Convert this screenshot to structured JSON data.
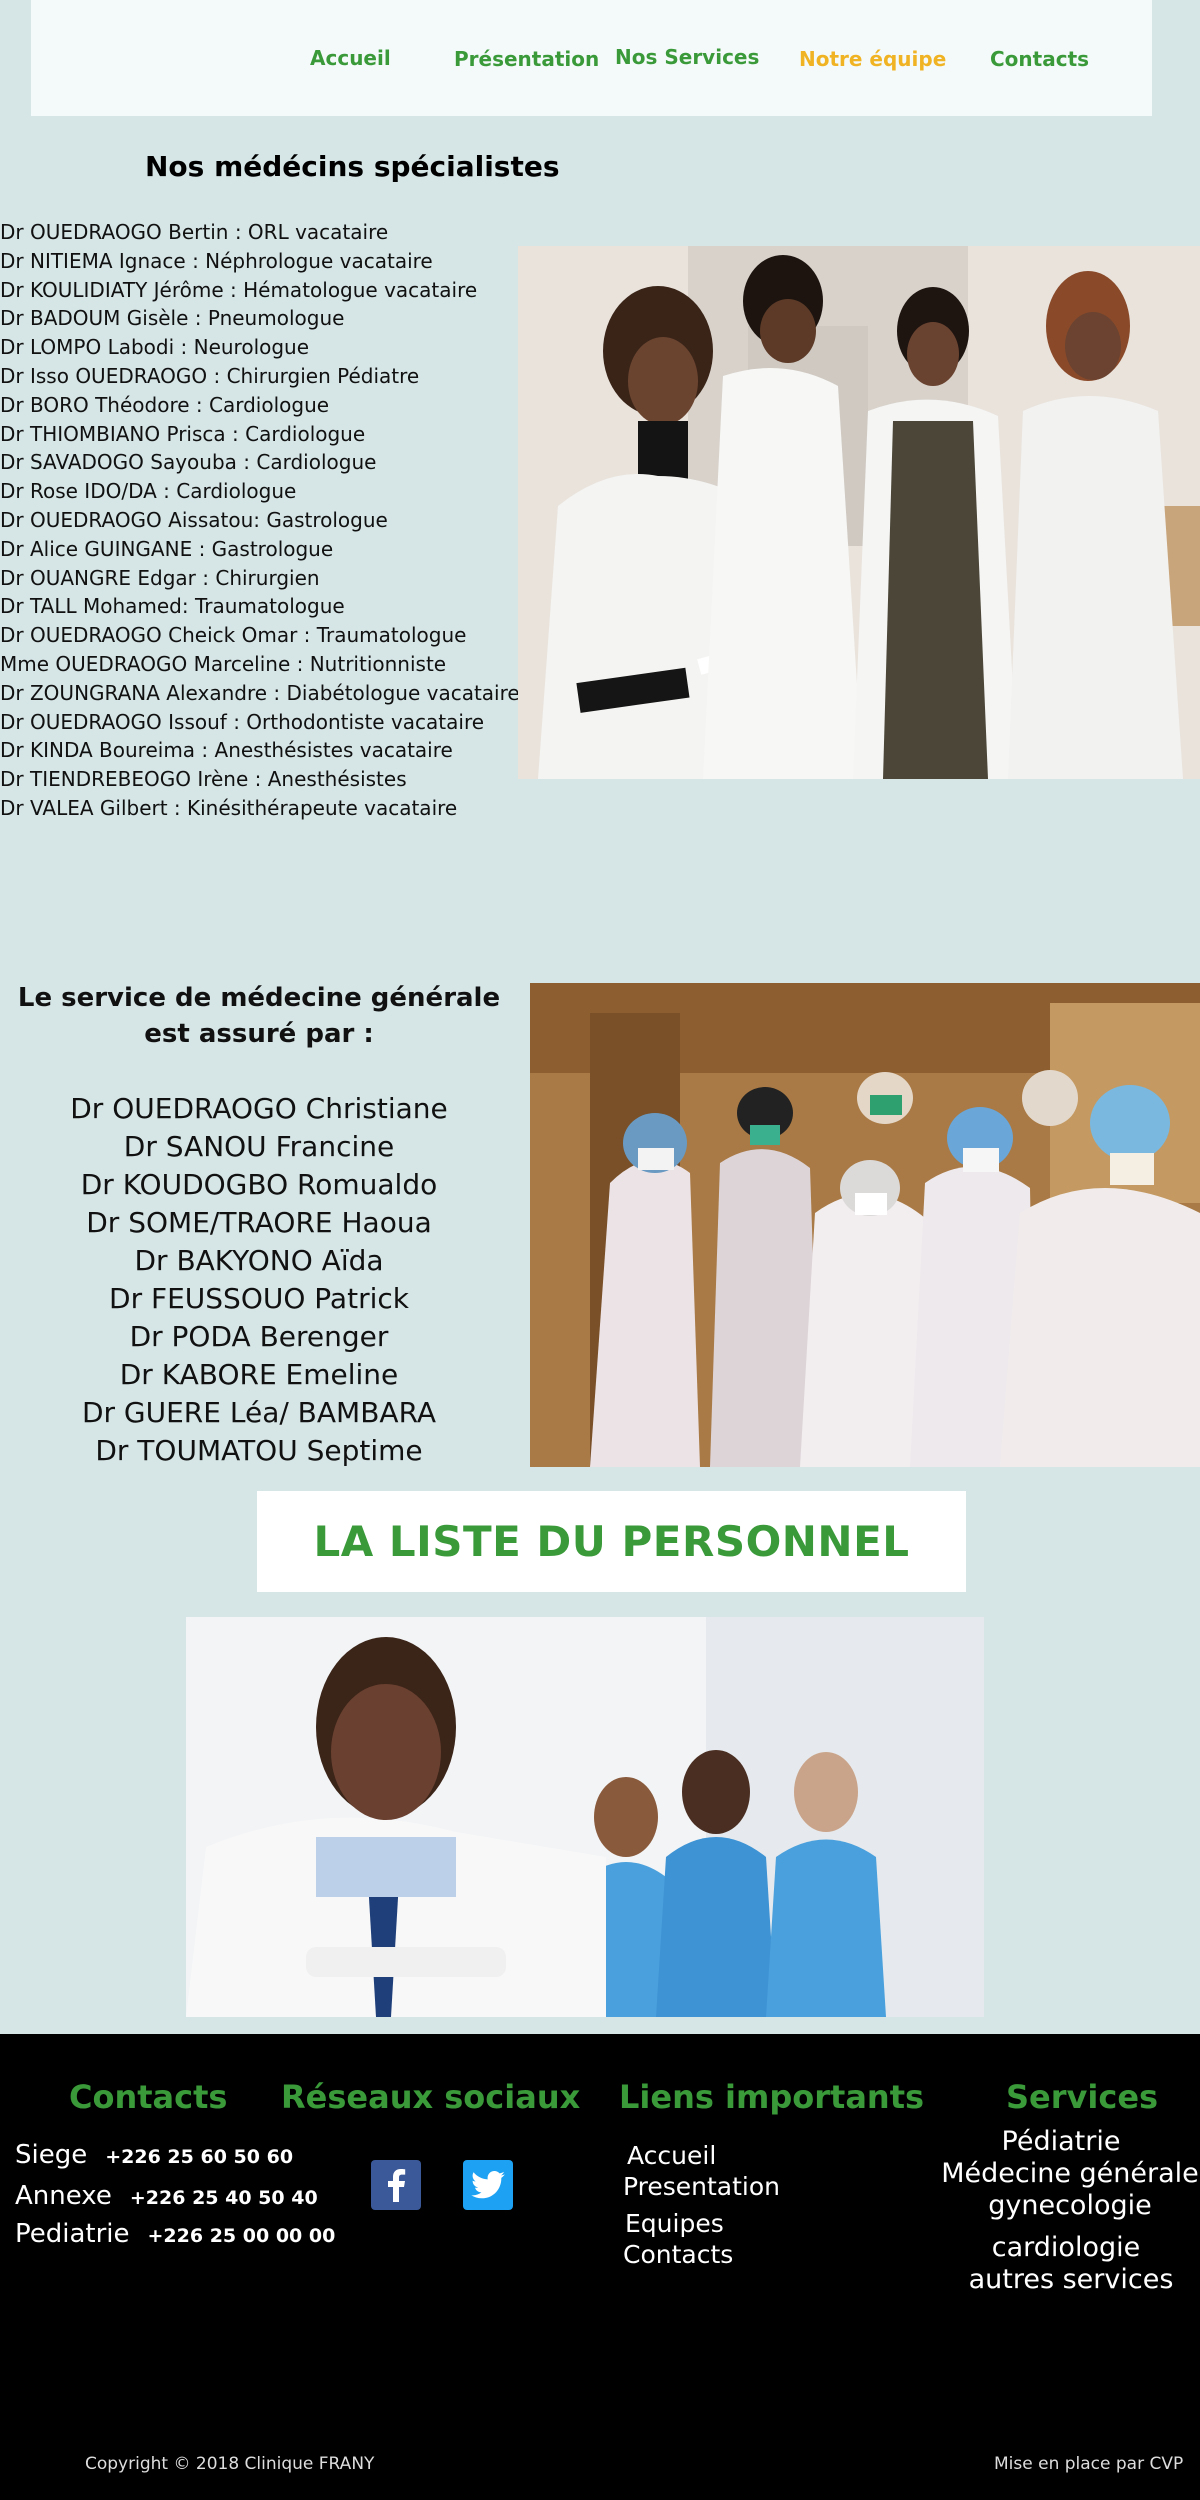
{
  "nav": {
    "items": [
      "Accueil",
      "Présentation",
      "Nos Services",
      "Notre équipe",
      "Contacts"
    ]
  },
  "specialists": {
    "title": "Nos médécins spécialistes",
    "list": [
      "Dr OUEDRAOGO Bertin : ORL vacataire",
      "Dr NITIEMA Ignace : Néphrologue vacataire",
      "Dr KOULIDIATY  Jérôme : Hématologue vacataire",
      "Dr BADOUM Gisèle : Pneumologue",
      "Dr LOMPO Labodi : Neurologue",
      "Dr Isso OUEDRAOGO : Chirurgien Pédiatre",
      "Dr BORO Théodore : Cardiologue",
      "Dr THIOMBIANO Prisca : Cardiologue",
      "Dr SAVADOGO Sayouba : Cardiologue",
      "Dr Rose IDO/DA : Cardiologue",
      "Dr OUEDRAOGO Aissatou: Gastrologue",
      "Dr Alice GUINGANE : Gastrologue",
      "Dr OUANGRE  Edgar : Chirurgien",
      "Dr TALL Mohamed: Traumatologue",
      "Dr OUEDRAOGO Cheick Omar : Traumatologue",
      "Mme OUEDRAOGO Marceline : Nutritionniste",
      "Dr ZOUNGRANA Alexandre : Diabétologue vacataire",
      "Dr OUEDRAOGO Issouf : Orthodontiste vacataire",
      "Dr KINDA Boureima : Anesthésistes vacataire",
      "Dr TIENDREBEOGO Irène : Anesthésistes",
      "Dr VALEA Gilbert : Kinésithérapeute vacataire"
    ]
  },
  "general": {
    "title": "Le service de  médecine générale est assuré par :",
    "list": [
      "Dr OUEDRAOGO Christiane",
      "Dr SANOU Francine",
      "Dr KOUDOGBO Romualdo",
      "Dr SOME/TRAORE Haoua",
      "Dr BAKYONO Aïda",
      "Dr FEUSSOUO Patrick",
      "Dr PODA Berenger",
      "Dr KABORE Emeline",
      "Dr GUERE Léa/ BAMBARA",
      "Dr TOUMATOU Septime"
    ]
  },
  "banner": {
    "label": "LA LISTE DU PERSONNEL"
  },
  "footer": {
    "contacts": {
      "title": "Contacts",
      "rows": [
        {
          "label": "Siege",
          "number": "+226 25 60 50 60"
        },
        {
          "label": "Annexe",
          "number": "+226 25 40 50 40"
        },
        {
          "label": "Pediatrie",
          "number": "+226 25 00 00 00"
        }
      ]
    },
    "social": {
      "title": "Réseaux sociaux",
      "icons": [
        "facebook-icon",
        "twitter-icon"
      ]
    },
    "links": {
      "title": "Liens importants",
      "items": [
        "Accueil",
        "Presentation",
        "Equipes",
        "Contacts"
      ]
    },
    "services": {
      "title": "Services",
      "items": [
        "Pédiatrie",
        "Médecine générale",
        "gynecologie",
        "cardiologie",
        "autres services"
      ]
    },
    "copyright": "Copyright © 2018 Clinique FRANY",
    "credit": "Mise en place par CVP"
  },
  "colors": {
    "page_bg": "#d6e5e6",
    "accent_green": "#3a9a3a",
    "active_nav": "#f0b323",
    "footer_bg": "#000000",
    "facebook": "#3b5998",
    "twitter": "#1da1f2"
  }
}
